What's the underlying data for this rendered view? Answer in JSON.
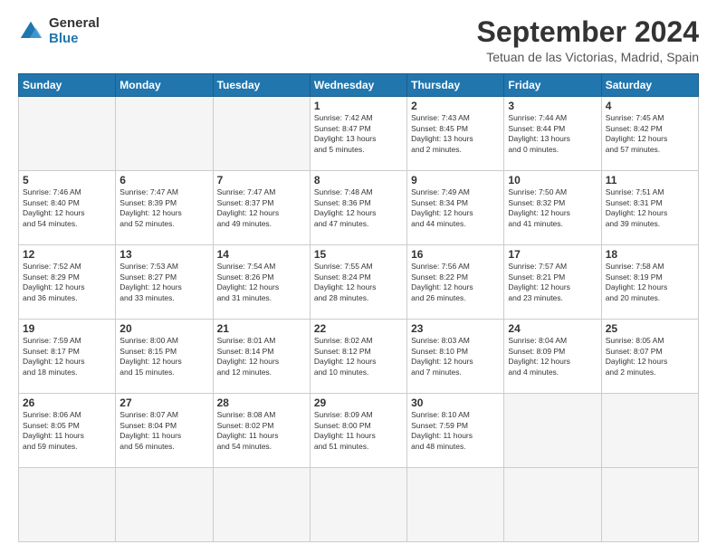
{
  "logo": {
    "general": "General",
    "blue": "Blue"
  },
  "header": {
    "month": "September 2024",
    "location": "Tetuan de las Victorias, Madrid, Spain"
  },
  "weekdays": [
    "Sunday",
    "Monday",
    "Tuesday",
    "Wednesday",
    "Thursday",
    "Friday",
    "Saturday"
  ],
  "days": [
    {
      "num": "",
      "info": ""
    },
    {
      "num": "",
      "info": ""
    },
    {
      "num": "",
      "info": ""
    },
    {
      "num": "1",
      "info": "Sunrise: 7:42 AM\nSunset: 8:47 PM\nDaylight: 13 hours\nand 5 minutes."
    },
    {
      "num": "2",
      "info": "Sunrise: 7:43 AM\nSunset: 8:45 PM\nDaylight: 13 hours\nand 2 minutes."
    },
    {
      "num": "3",
      "info": "Sunrise: 7:44 AM\nSunset: 8:44 PM\nDaylight: 13 hours\nand 0 minutes."
    },
    {
      "num": "4",
      "info": "Sunrise: 7:45 AM\nSunset: 8:42 PM\nDaylight: 12 hours\nand 57 minutes."
    },
    {
      "num": "5",
      "info": "Sunrise: 7:46 AM\nSunset: 8:40 PM\nDaylight: 12 hours\nand 54 minutes."
    },
    {
      "num": "6",
      "info": "Sunrise: 7:47 AM\nSunset: 8:39 PM\nDaylight: 12 hours\nand 52 minutes."
    },
    {
      "num": "7",
      "info": "Sunrise: 7:47 AM\nSunset: 8:37 PM\nDaylight: 12 hours\nand 49 minutes."
    },
    {
      "num": "8",
      "info": "Sunrise: 7:48 AM\nSunset: 8:36 PM\nDaylight: 12 hours\nand 47 minutes."
    },
    {
      "num": "9",
      "info": "Sunrise: 7:49 AM\nSunset: 8:34 PM\nDaylight: 12 hours\nand 44 minutes."
    },
    {
      "num": "10",
      "info": "Sunrise: 7:50 AM\nSunset: 8:32 PM\nDaylight: 12 hours\nand 41 minutes."
    },
    {
      "num": "11",
      "info": "Sunrise: 7:51 AM\nSunset: 8:31 PM\nDaylight: 12 hours\nand 39 minutes."
    },
    {
      "num": "12",
      "info": "Sunrise: 7:52 AM\nSunset: 8:29 PM\nDaylight: 12 hours\nand 36 minutes."
    },
    {
      "num": "13",
      "info": "Sunrise: 7:53 AM\nSunset: 8:27 PM\nDaylight: 12 hours\nand 33 minutes."
    },
    {
      "num": "14",
      "info": "Sunrise: 7:54 AM\nSunset: 8:26 PM\nDaylight: 12 hours\nand 31 minutes."
    },
    {
      "num": "15",
      "info": "Sunrise: 7:55 AM\nSunset: 8:24 PM\nDaylight: 12 hours\nand 28 minutes."
    },
    {
      "num": "16",
      "info": "Sunrise: 7:56 AM\nSunset: 8:22 PM\nDaylight: 12 hours\nand 26 minutes."
    },
    {
      "num": "17",
      "info": "Sunrise: 7:57 AM\nSunset: 8:21 PM\nDaylight: 12 hours\nand 23 minutes."
    },
    {
      "num": "18",
      "info": "Sunrise: 7:58 AM\nSunset: 8:19 PM\nDaylight: 12 hours\nand 20 minutes."
    },
    {
      "num": "19",
      "info": "Sunrise: 7:59 AM\nSunset: 8:17 PM\nDaylight: 12 hours\nand 18 minutes."
    },
    {
      "num": "20",
      "info": "Sunrise: 8:00 AM\nSunset: 8:15 PM\nDaylight: 12 hours\nand 15 minutes."
    },
    {
      "num": "21",
      "info": "Sunrise: 8:01 AM\nSunset: 8:14 PM\nDaylight: 12 hours\nand 12 minutes."
    },
    {
      "num": "22",
      "info": "Sunrise: 8:02 AM\nSunset: 8:12 PM\nDaylight: 12 hours\nand 10 minutes."
    },
    {
      "num": "23",
      "info": "Sunrise: 8:03 AM\nSunset: 8:10 PM\nDaylight: 12 hours\nand 7 minutes."
    },
    {
      "num": "24",
      "info": "Sunrise: 8:04 AM\nSunset: 8:09 PM\nDaylight: 12 hours\nand 4 minutes."
    },
    {
      "num": "25",
      "info": "Sunrise: 8:05 AM\nSunset: 8:07 PM\nDaylight: 12 hours\nand 2 minutes."
    },
    {
      "num": "26",
      "info": "Sunrise: 8:06 AM\nSunset: 8:05 PM\nDaylight: 11 hours\nand 59 minutes."
    },
    {
      "num": "27",
      "info": "Sunrise: 8:07 AM\nSunset: 8:04 PM\nDaylight: 11 hours\nand 56 minutes."
    },
    {
      "num": "28",
      "info": "Sunrise: 8:08 AM\nSunset: 8:02 PM\nDaylight: 11 hours\nand 54 minutes."
    },
    {
      "num": "29",
      "info": "Sunrise: 8:09 AM\nSunset: 8:00 PM\nDaylight: 11 hours\nand 51 minutes."
    },
    {
      "num": "30",
      "info": "Sunrise: 8:10 AM\nSunset: 7:59 PM\nDaylight: 11 hours\nand 48 minutes."
    },
    {
      "num": "",
      "info": ""
    },
    {
      "num": "",
      "info": ""
    },
    {
      "num": "",
      "info": ""
    },
    {
      "num": "",
      "info": ""
    },
    {
      "num": "",
      "info": ""
    }
  ]
}
